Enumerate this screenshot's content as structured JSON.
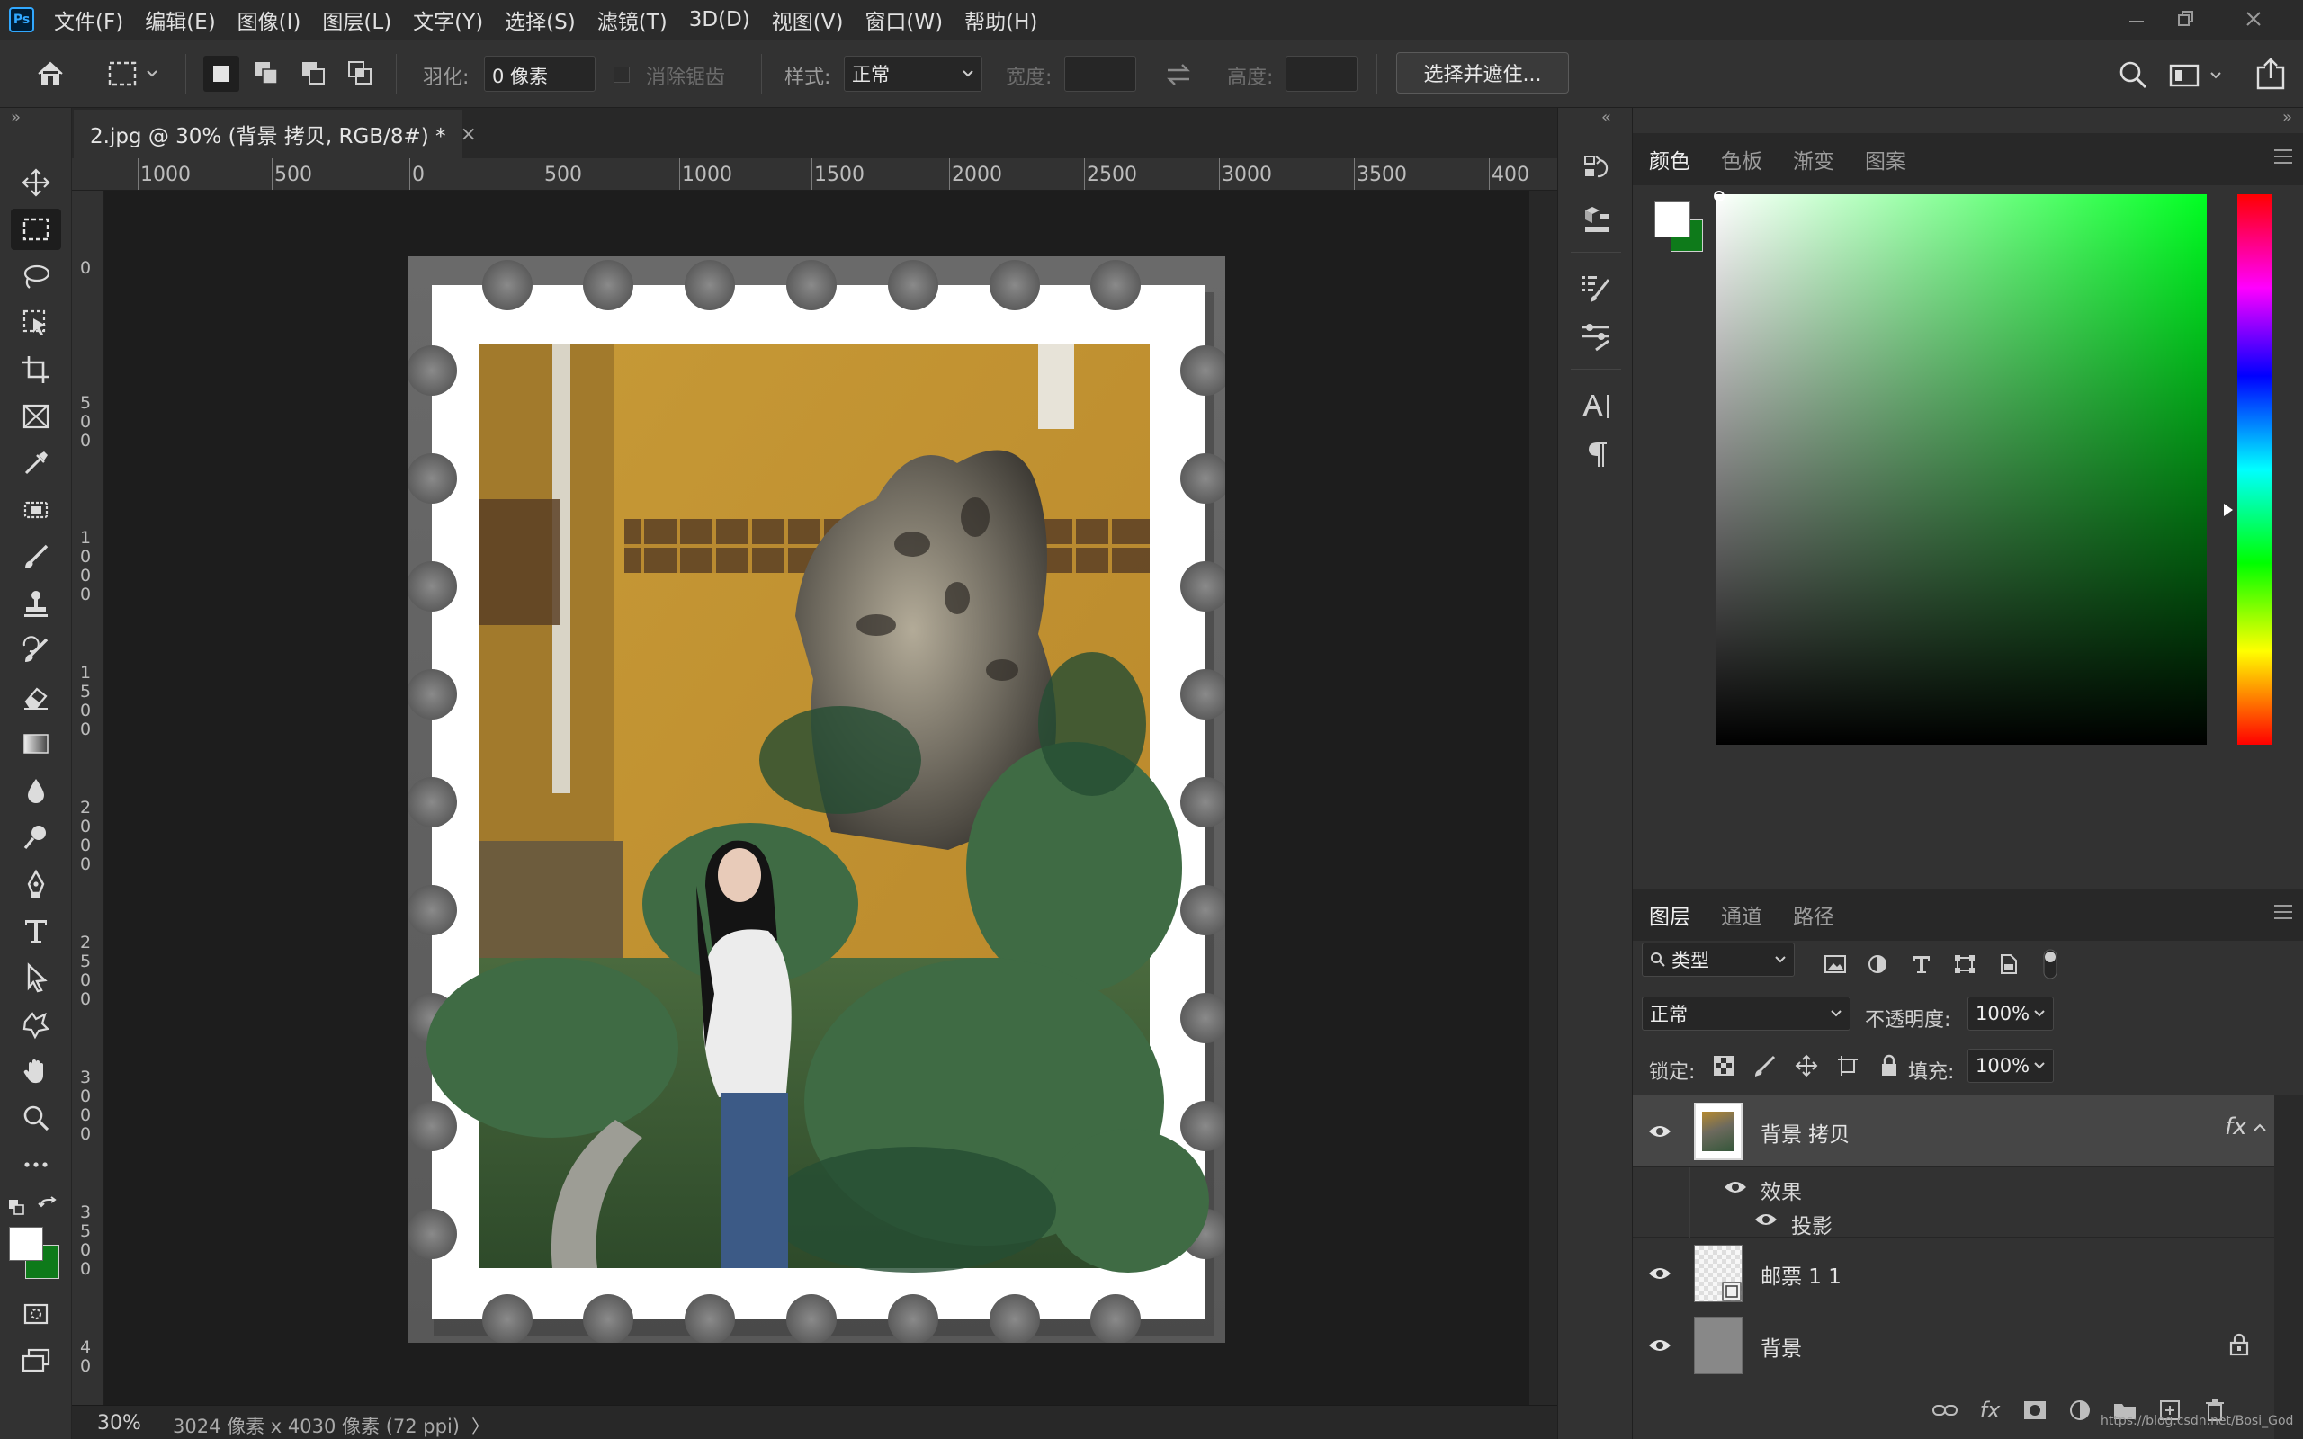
{
  "app": {
    "logo": "Ps"
  },
  "menu": [
    "文件(F)",
    "编辑(E)",
    "图像(I)",
    "图层(L)",
    "文字(Y)",
    "选择(S)",
    "滤镜(T)",
    "3D(D)",
    "视图(V)",
    "窗口(W)",
    "帮助(H)"
  ],
  "options": {
    "feather_label": "羽化:",
    "feather_value": "0 像素",
    "antialias_label": "消除锯齿",
    "style_label": "样式:",
    "style_value": "正常",
    "width_label": "宽度:",
    "height_label": "高度:",
    "select_mask_button": "选择并遮住..."
  },
  "document": {
    "tab_title": "2.jpg @ 30% (背景 拷贝, RGB/8#) *",
    "close_glyph": "×",
    "ruler_top": [
      "1000",
      "500",
      "0",
      "500",
      "1000",
      "1500",
      "2000",
      "2500",
      "3000",
      "3500",
      "400"
    ],
    "ruler_left": [
      "0",
      "5\n0\n0",
      "1\n0\n0\n0",
      "1\n5\n0\n0",
      "2\n0\n0\n0",
      "2\n5\n0\n0",
      "3\n0\n0\n0",
      "3\n5\n0\n0",
      "4\n0"
    ]
  },
  "status": {
    "zoom": "30%",
    "doc_info": "3024 像素 x 4030 像素 (72 ppi)",
    "arrow": "〉"
  },
  "color_panel": {
    "tabs": [
      "颜色",
      "色板",
      "渐变",
      "图案"
    ],
    "active_tab": "颜色",
    "foreground": "#ffffff",
    "background": "#0e7a1a",
    "hue_color": "#00ff22"
  },
  "layers_panel": {
    "tabs": [
      "图层",
      "通道",
      "路径"
    ],
    "active_tab": "图层",
    "filter_label": "类型",
    "blend_mode": "正常",
    "opacity_label": "不透明度:",
    "opacity_value": "100%",
    "lock_label": "锁定:",
    "fill_label": "填充:",
    "fill_value": "100%",
    "fx_label": "fx",
    "effects_label": "效果",
    "effect_item": "投影",
    "layers": [
      {
        "name": "背景 拷贝",
        "selected": true,
        "has_fx": true
      },
      {
        "name": "邮票 1 1",
        "selected": false
      },
      {
        "name": "背景",
        "selected": false,
        "locked": true
      }
    ]
  },
  "watermark": "https://blog.csdn.net/Bosi_God"
}
